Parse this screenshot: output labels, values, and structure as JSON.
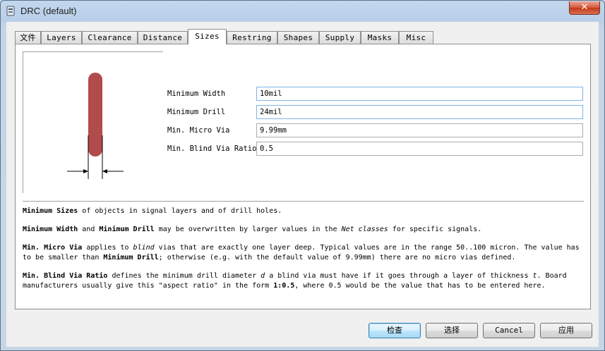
{
  "window": {
    "title": "DRC (default)",
    "close_label": "✕"
  },
  "tabs": [
    {
      "label": "文件"
    },
    {
      "label": "Layers"
    },
    {
      "label": "Clearance"
    },
    {
      "label": "Distance"
    },
    {
      "label": "Sizes"
    },
    {
      "label": "Restring"
    },
    {
      "label": "Shapes"
    },
    {
      "label": "Supply"
    },
    {
      "label": "Masks"
    },
    {
      "label": "Misc"
    }
  ],
  "active_tab": "Sizes",
  "colors": {
    "trace": "#b24b4b",
    "accent": "#3c7fb1"
  },
  "fields": [
    {
      "label": "Minimum Width",
      "value": "10mil"
    },
    {
      "label": "Minimum Drill",
      "value": "24mil"
    },
    {
      "label": "Min. Micro Via",
      "value": "9.99mm"
    },
    {
      "label": "Min. Blind Via Ratio",
      "value": "0.5"
    }
  ],
  "help": {
    "p1": {
      "b1": "Minimum Sizes",
      "t1": " of objects in signal layers and of drill holes."
    },
    "p2": {
      "b1": "Minimum Width",
      "t1": " and ",
      "b2": "Minimum Drill",
      "t2": " may be overwritten by larger values in the ",
      "i1": "Net classes",
      "t3": " for specific signals."
    },
    "p3": {
      "b1": "Min. Micro Via",
      "t1": " applies to ",
      "i1": "blind",
      "t2": " vias that are exactly one layer deep. Typical values are in the range 50..100 micron. The value has to be smaller than ",
      "b2": "Minimum Drill",
      "t3": "; otherwise (e.g. with the default value of 9.99mm) there are no micro vias defined."
    },
    "p4": {
      "b1": "Min. Blind Via Ratio",
      "t1": " defines the minimum drill diameter ",
      "i1": "d",
      "t2": " a blind via must have if it goes through a layer of thickness ",
      "i2": "t",
      "t3": ". Board manufacturers usually give this \"aspect ratio\" in the form ",
      "b2": "1:0.5",
      "t4": ", where 0.5 would be the value that has to be entered here."
    }
  },
  "buttons": {
    "check": "检查",
    "select": "选择",
    "cancel": "Cancel",
    "apply": "应用"
  }
}
